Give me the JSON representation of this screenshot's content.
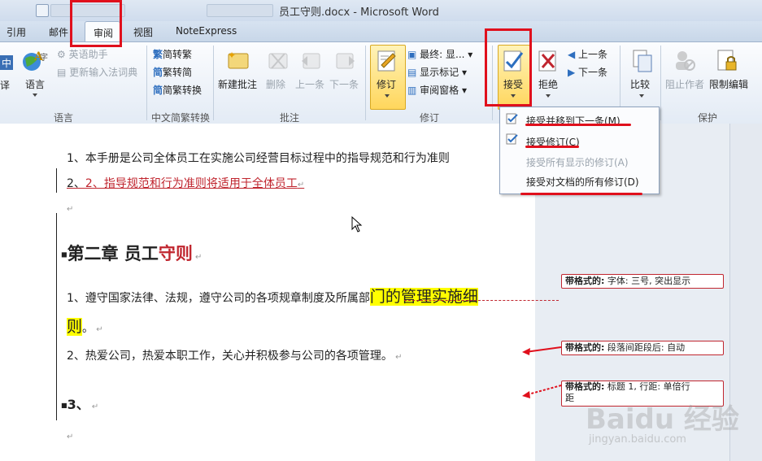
{
  "window": {
    "title": "员工守则.docx - Microsoft Word"
  },
  "tabs": [
    "引用",
    "邮件",
    "审阅",
    "视图",
    "NoteExpress"
  ],
  "ribbon": {
    "language": {
      "translate": "译",
      "language_btn": "语言",
      "english_assistant": "英语助手",
      "update_ime": "更新输入法词典",
      "group": "语言"
    },
    "chinese": {
      "to_traditional": "简转繁",
      "to_simplified": "繁转简",
      "convert": "简繁转换",
      "group": "中文简繁转换"
    },
    "comments": {
      "new": "新建批注",
      "delete": "删除",
      "prev": "上一条",
      "next": "下一条",
      "group": "批注"
    },
    "tracking": {
      "track": "修订",
      "final": "最终: 显...",
      "show_markup": "显示标记",
      "review_pane": "审阅窗格",
      "group": "修订"
    },
    "changes": {
      "accept": "接受",
      "reject": "拒绝",
      "prev": "上一条",
      "next": "下一条"
    },
    "compare": {
      "compare": "比较"
    },
    "protect": {
      "block_authors": "阻止作者",
      "restrict_editing": "限制编辑",
      "group": "保护"
    }
  },
  "accept_menu": [
    {
      "label": "接受并移到下一条(M)",
      "enabled": true
    },
    {
      "label": "接受修订(C)",
      "enabled": true
    },
    {
      "label": "接受所有显示的修订(A)",
      "enabled": false
    },
    {
      "label": "接受对文档的所有修订(D)",
      "enabled": true
    }
  ],
  "document": {
    "line1": "1、本手册是公司全体员工在实施公司经营目标过程中的指导规范和行为准则",
    "line2": "2、指导规范和行为准则将适用于全体员工",
    "chapter_a": "第二章  员工",
    "chapter_b": "守则",
    "para1_a": "1、遵守国家法律、法规，遵守公司的各项规章制度及所属部",
    "para1_b": "门的管理实施细",
    "para1_c": "则",
    "para1_d": "。",
    "para2": "2、热爱公司，热爱本职工作，关心并积极参与公司的各项管理。",
    "para3": "3、"
  },
  "balloons": [
    {
      "label": "带格式的:",
      "text": "字体: 三号, 突出显示"
    },
    {
      "label": "带格式的:",
      "text": "段落间距段后: 自动"
    },
    {
      "label": "带格式的:",
      "text": "标题 1, 行距: 单倍行",
      "text2": "距"
    }
  ],
  "watermark": {
    "brand": "Baidu 经验",
    "url": "jingyan.baidu.com"
  },
  "colors": {
    "accent": "#e0101c",
    "insert": "#c0262f",
    "highlight": "#ffff00"
  }
}
